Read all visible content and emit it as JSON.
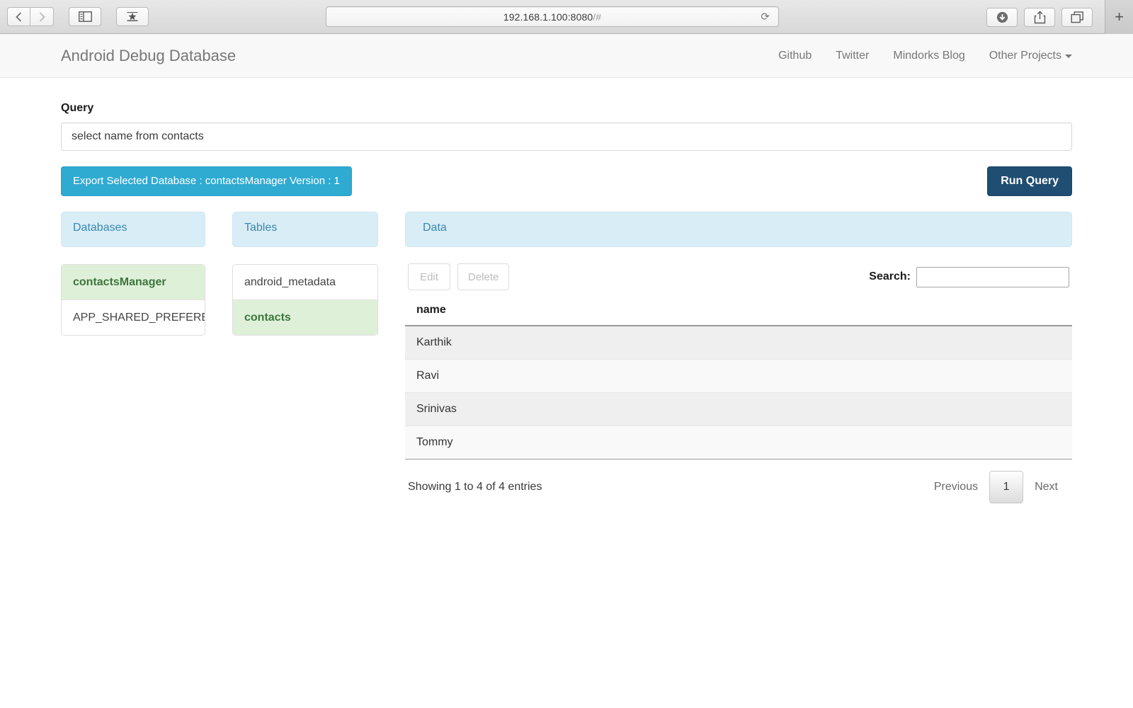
{
  "browser": {
    "url_host": "192.168.1.100:8080",
    "url_path": "/#",
    "back_icon": "back-arrow-icon",
    "forward_icon": "forward-arrow-icon",
    "sidebar_icon": "sidebar-toggle-icon",
    "bookmarks_icon": "bookmarks-star-icon",
    "downloads_icon": "downloads-icon",
    "share_icon": "share-icon",
    "tabs_icon": "tab-overview-icon",
    "newtab_label": "+",
    "reload_icon": "reload-icon"
  },
  "navbar": {
    "brand": "Android Debug Database",
    "links": [
      {
        "label": "Github"
      },
      {
        "label": "Twitter"
      },
      {
        "label": "Mindorks Blog"
      },
      {
        "label": "Other Projects"
      }
    ]
  },
  "query": {
    "label": "Query",
    "value": "select name from contacts",
    "placeholder": ""
  },
  "actions": {
    "export_label": "Export Selected Database : contactsManager Version : 1",
    "run_label": "Run Query"
  },
  "panels": {
    "databases": {
      "title": "Databases",
      "items": [
        {
          "label": "contactsManager",
          "selected": true
        },
        {
          "label": "APP_SHARED_PREFERENCES",
          "selected": false
        }
      ]
    },
    "tables": {
      "title": "Tables",
      "items": [
        {
          "label": "android_metadata",
          "selected": false
        },
        {
          "label": "contacts",
          "selected": true
        }
      ]
    },
    "data": {
      "title": "Data",
      "edit_label": "Edit",
      "delete_label": "Delete",
      "search_label": "Search:",
      "search_value": "",
      "search_placeholder": "",
      "columns": [
        "name"
      ],
      "rows": [
        [
          "Karthik"
        ],
        [
          "Ravi"
        ],
        [
          "Srinivas"
        ],
        [
          "Tommy"
        ]
      ],
      "showing_info": "Showing 1 to 4 of 4 entries",
      "pagination": {
        "previous_label": "Previous",
        "current_page": "1",
        "next_label": "Next"
      }
    }
  },
  "colors": {
    "panel_header_bg": "#d9edf7",
    "panel_header_text": "#3a87ad",
    "selected_bg": "#dff0d8",
    "selected_text": "#3c763d",
    "export_button_bg": "#2fabd2",
    "run_button_bg": "#1f4e72",
    "navbar_bg": "#f8f8f8"
  }
}
